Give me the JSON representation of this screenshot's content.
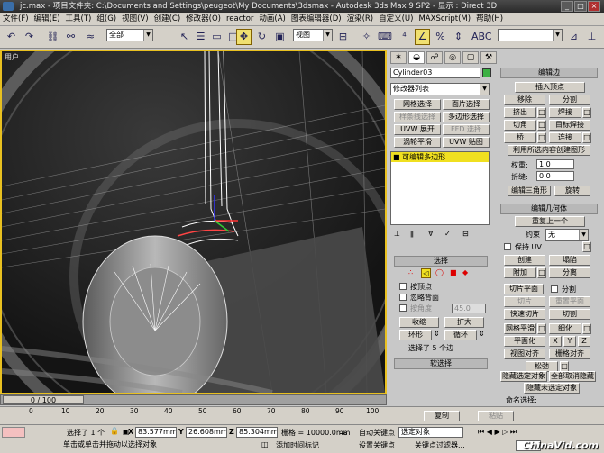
{
  "window": {
    "title": "jc.max    - 项目文件夹: C:\\Documents and Settings\\peugeot\\My Documents\\3dsmax    - Autodesk 3ds Max 9 SP2    - 显示 : Direct 3D",
    "min": "_",
    "max": "□",
    "close": "×"
  },
  "menu": [
    "文件(F)",
    "编辑(E)",
    "工具(T)",
    "组(G)",
    "视图(V)",
    "创建(C)",
    "修改器(O)",
    "reactor",
    "动画(A)",
    "图表编辑器(D)",
    "渲染(R)",
    "自定义(U)",
    "MAXScript(M)",
    "帮助(H)"
  ],
  "toolbar": {
    "selection_filter": "全部",
    "ref_coord": "视图",
    "named_set": ""
  },
  "viewport": {
    "label": "用户"
  },
  "panel": {
    "object_name": "Cylinder03",
    "object_color": "#3cb043",
    "modifier_list": "修改器列表",
    "buttons_top": [
      "网格选择",
      "面片选择",
      "样条线选择",
      "多边形选择",
      "UVW 展开",
      "FFD 选择",
      "涡轮平滑",
      "UVW 贴图"
    ],
    "stack_item": "可编辑多边形",
    "select_rollout": "选择",
    "by_vertex": "按顶点",
    "ignore_backfacing": "忽略背面",
    "by_angle": "按角度",
    "angle_value": "45.0",
    "shrink": "收缩",
    "grow": "扩大",
    "ring": "环形",
    "loop": "循环",
    "selected_info": "选择了 5 个边",
    "soft_select": "软选择",
    "edit_edges": "编辑边",
    "insert_vertex": "插入顶点",
    "remove": "移除",
    "split": "分割",
    "extrude": "挤出",
    "weld": "焊接",
    "chamfer": "切角",
    "target_weld": "目标焊接",
    "bridge": "桥",
    "connect": "连接",
    "create_shape": "利用所选内容创建图形",
    "weight_label": "权重:",
    "weight": "1.0",
    "crease_label": "折缝:",
    "crease": "0.0",
    "edit_tri": "编辑三角形",
    "turn": "旋转",
    "edit_geom": "编辑几何体",
    "repeat_last": "重复上一个",
    "constraints_label": "约束",
    "constraints": "无",
    "preserve_uv": "保持 UV",
    "create": "创建",
    "collapse": "塌陷",
    "attach": "附加",
    "detach": "分离",
    "slice_plane": "切片平面",
    "split2": "分割",
    "slice": "切片",
    "reset_plane": "重置平面",
    "quickslice": "快速切片",
    "cut": "切割",
    "msmooth": "网格平滑",
    "tessellate": "细化",
    "make_planar": "平面化",
    "x": "X",
    "y": "Y",
    "z": "Z",
    "view_align": "视图对齐",
    "grid_align": "栅格对齐",
    "relax": "松弛",
    "hide_sel": "隐藏选定对象",
    "unhide_all": "全部取消隐藏",
    "hide_unsel": "隐藏未选定对象",
    "named_sel": "命名选择:",
    "copy": "复制",
    "paste": "粘贴",
    "delete_iso": "删除孤立顶点"
  },
  "timeline": {
    "slider": "0 / 100",
    "ticks": [
      "0",
      "10",
      "20",
      "30",
      "40",
      "50",
      "60",
      "70",
      "80",
      "90",
      "100"
    ]
  },
  "status": {
    "selected": "选择了 1 个",
    "x_label": "X",
    "x": "83.577mm",
    "y_label": "Y",
    "y": "26.608mm",
    "z_label": "Z",
    "z": "85.304mm",
    "grid": "栅格 = 10000.0mm",
    "prompt": "单击或单击并拖动以选择对象",
    "add_tag": "添加时间标记",
    "autokey": "自动关键点",
    "setkey": "设置关键点",
    "sel_obj": "选定对象",
    "key_filters": "关键点过滤器...",
    "watermark": "ChinaVid.com"
  }
}
